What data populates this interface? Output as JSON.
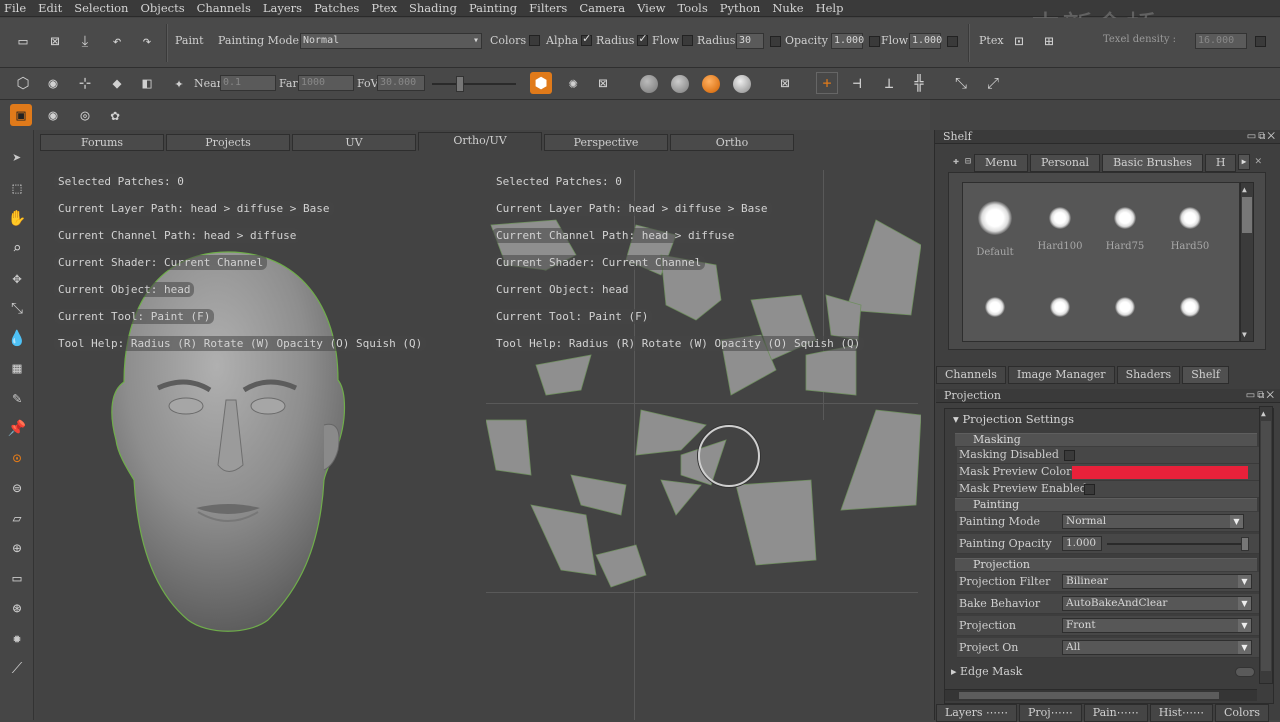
{
  "menu": [
    "File",
    "Edit",
    "Selection",
    "Objects",
    "Channels",
    "Layers",
    "Patches",
    "Ptex",
    "Shading",
    "Painting",
    "Filters",
    "Camera",
    "View",
    "Tools",
    "Python",
    "Nuke",
    "Help"
  ],
  "watermark": "中新金桥",
  "toolbar": {
    "paint_label": "Paint",
    "painting_mode_label": "Painting Mode",
    "painting_mode_value": "Normal",
    "colors_label": "Colors",
    "alpha_label": "Alpha",
    "radius_check_label": "Radius",
    "flow_check_label": "Flow",
    "radius_label": "Radius",
    "radius_value": "30",
    "opacity_label": "Opacity",
    "opacity_value": "1.000",
    "flow_label": "Flow",
    "flow_value": "1.000",
    "ptex_label": "Ptex",
    "texel_density_label": "Texel density :",
    "texel_density_value": "16.000",
    "near_label": "Near",
    "near_value": "0.1",
    "far_label": "Far",
    "far_value": "1000",
    "fov_label": "FoV",
    "fov_value": "30.000"
  },
  "viewport": {
    "tabs": [
      "Forums",
      "Projects",
      "UV",
      "Ortho/UV",
      "Perspective",
      "Ortho"
    ],
    "active_tab": "Ortho/UV",
    "left_info": {
      "selected_patches": "Selected Patches: 0",
      "layer_path": "Current Layer Path: head > diffuse > Base",
      "channel_path": "Current Channel Path: head > diffuse",
      "shader": "Current Shader: Current Channel",
      "object": "Current Object: head",
      "tool": "Current Tool: Paint (F)",
      "tool_help": "Tool Help:   Radius (R)   Rotate (W)   Opacity (O)   Squish (Q)"
    },
    "right_info": {
      "selected_patches": "Selected Patches: 0",
      "layer_path": "Current Layer Path: head > diffuse > Base",
      "channel_path": "Current Channel Path: head > diffuse",
      "shader": "Current Shader: Current Channel",
      "object": "Current Object: head",
      "tool": "Current Tool: Paint (F)",
      "tool_help": "Tool Help:   Radius (R)   Rotate (W)   Opacity (O)   Squish (Q)"
    }
  },
  "shelf": {
    "title": "Shelf",
    "tabs": [
      "Menu",
      "Personal",
      "Basic Brushes",
      "H"
    ],
    "active_tab": "Basic Brushes",
    "brushes": [
      "Default",
      "Hard100",
      "Hard75",
      "Hard50",
      "",
      "",
      "",
      ""
    ]
  },
  "bottom_tabs_1": [
    "Channels",
    "Image Manager",
    "Shaders",
    "Shelf"
  ],
  "bottom_tabs_1_active": "Shelf",
  "projection_panel": {
    "title": "Projection",
    "header": "Projection Settings",
    "masking_section": "Masking",
    "masking_disabled": "Masking Disabled",
    "mask_preview_color": "Mask Preview Color",
    "mask_preview_color_value": "#e8213a",
    "mask_preview_enabled": "Mask Preview Enabled",
    "painting_section": "Painting",
    "painting_mode_label": "Painting Mode",
    "painting_mode_value": "Normal",
    "painting_opacity_label": "Painting Opacity",
    "painting_opacity_value": "1.000",
    "projection_section": "Projection",
    "projection_filter_label": "Projection Filter",
    "projection_filter_value": "Bilinear",
    "bake_behavior_label": "Bake Behavior",
    "bake_behavior_value": "AutoBakeAndClear",
    "projection_label": "Projection",
    "projection_value": "Front",
    "project_on_label": "Project On",
    "project_on_value": "All",
    "edge_mask_label": "Edge Mask"
  },
  "bottom_tabs_2": [
    "Layers ⋯⋯",
    "Proj⋯⋯",
    "Pain⋯⋯",
    "Hist⋯⋯",
    "Colors"
  ],
  "colors": {
    "accent_orange": "#e07a1a",
    "mask_red": "#e8213a",
    "uv_patch": "#8f8f8f"
  }
}
